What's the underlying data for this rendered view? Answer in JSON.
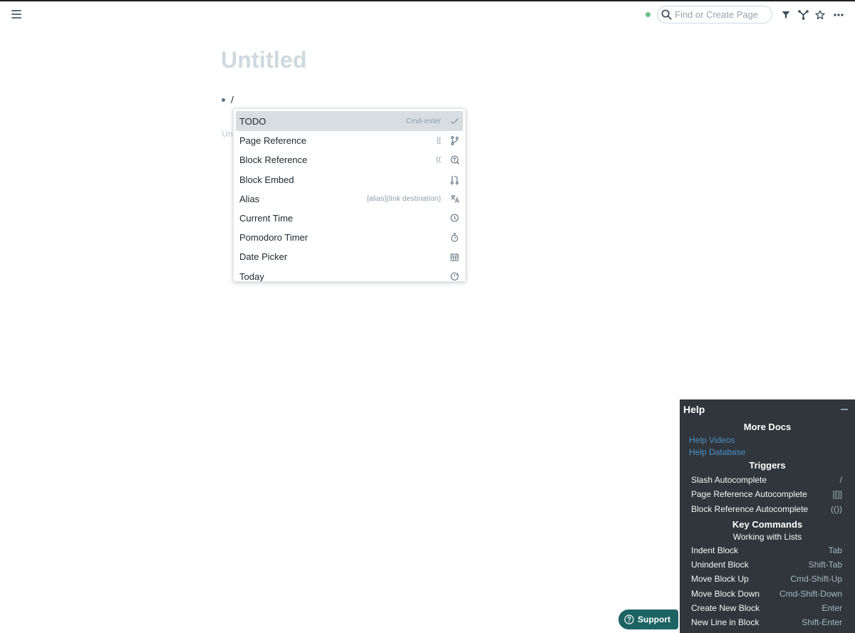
{
  "topbar": {
    "menu_icon": "hamburger-menu-icon",
    "sync_status_color": "#6bbd8a",
    "search": {
      "placeholder": "Find or Create Page",
      "value": ""
    },
    "icons": [
      "filter-icon",
      "graph-icon",
      "star-icon",
      "more-icon"
    ]
  },
  "page": {
    "title": "Untitled",
    "blocks": [
      {
        "text": "/"
      }
    ],
    "ghost_reference": "Un"
  },
  "autocomplete": {
    "items": [
      {
        "label": "TODO",
        "hint": "Cmd-enter",
        "icon": "check-icon",
        "active": true
      },
      {
        "label": "Page Reference",
        "hint": "[[",
        "icon": "git-branch-icon"
      },
      {
        "label": "Block Reference",
        "hint": "((",
        "icon": "search-text-icon"
      },
      {
        "label": "Block Embed",
        "hint": "",
        "icon": "git-pull-icon"
      },
      {
        "label": "Alias",
        "hint": "[alias](link destination)",
        "icon": "translate-icon"
      },
      {
        "label": "Current Time",
        "hint": "",
        "icon": "clock-icon"
      },
      {
        "label": "Pomodoro Timer",
        "hint": "",
        "icon": "stopwatch-icon"
      },
      {
        "label": "Date Picker",
        "hint": "",
        "icon": "calendar-icon"
      },
      {
        "label": "Today",
        "hint": "",
        "icon": "history-icon"
      }
    ]
  },
  "help": {
    "title": "Help",
    "more_docs": "More Docs",
    "links": [
      "Help Videos",
      "Help Database"
    ],
    "triggers_heading": "Triggers",
    "triggers": [
      {
        "label": "Slash Autocomplete",
        "key": "/"
      },
      {
        "label": "Page Reference Autocomplete",
        "key": "[[]]"
      },
      {
        "label": "Block Reference Autocomplete",
        "key": "(())"
      }
    ],
    "key_commands_heading": "Key Commands",
    "lists_subheading": "Working with Lists",
    "commands": [
      {
        "label": "Indent Block",
        "key": "Tab"
      },
      {
        "label": "Unindent Block",
        "key": "Shift-Tab"
      },
      {
        "label": "Move Block Up",
        "key": "Cmd-Shift-Up"
      },
      {
        "label": "Move Block Down",
        "key": "Cmd-Shift-Down"
      },
      {
        "label": "Create New Block",
        "key": "Enter"
      },
      {
        "label": "New Line in Block",
        "key": "Shift-Enter"
      }
    ]
  },
  "support": {
    "label": "Support",
    "color": "#1e6363"
  }
}
